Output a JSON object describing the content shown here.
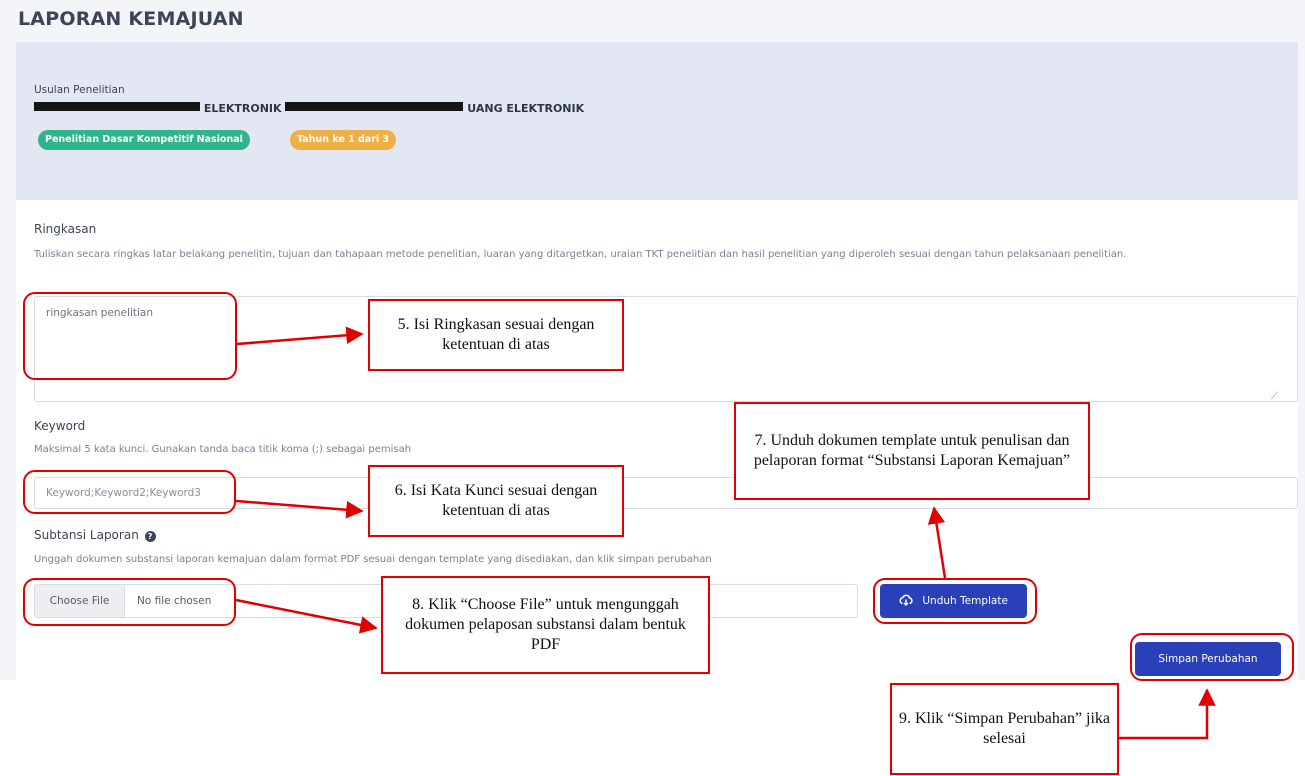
{
  "page": {
    "title": "LAPORAN KEMAJUAN"
  },
  "proposal": {
    "label": "Usulan Penelitian",
    "title_parts": [
      "ELEKTRONIK",
      "UANG ELEKTRONIK"
    ],
    "badges": [
      "Penelitian Dasar Kompetitif Nasional",
      "Tahun ke 1 dari 3"
    ],
    "badge_colors": [
      "#2fb58d",
      "#eeb044"
    ]
  },
  "ringkasan": {
    "label": "Ringkasan",
    "description": "Tuliskan secara ringkas latar belakang penelitin, tujuan dan tahapaan metode penelitian, luaran yang ditargetkan, uraian TKT penelitian dan hasil penelitian yang diperoleh sesuai dengan tahun pelaksanaan penelitian.",
    "value": "ringkasan penelitian"
  },
  "keyword": {
    "label": "Keyword",
    "description": "Maksimal 5 kata kunci. Gunakan tanda baca titik koma (;) sebagai pemisah",
    "placeholder": "Keyword;Keyword2;Keyword3"
  },
  "substansi": {
    "label": "Subtansi Laporan",
    "description": "Unggah dokumen substansi laporan kemajuan dalam format PDF sesuai dengan template yang disediakan, dan klik simpan perubahan",
    "choose_file": "Choose File",
    "no_file": "No file chosen",
    "download_label": "Unduh Template"
  },
  "actions": {
    "save_label": "Simpan Perubahan"
  },
  "colors": {
    "primary": "#2a40b9",
    "annotation": "#e00000",
    "header_bg": "#e3e7f3"
  },
  "annotations": {
    "step5": "5. Isi Ringkasan sesuai dengan ketentuan di atas",
    "step6": "6. Isi Kata Kunci sesuai dengan ketentuan di atas",
    "step7": "7. Unduh dokumen template untuk penulisan dan pelaporan format “Substansi Laporan Kemajuan”",
    "step8": "8. Klik “Choose File” untuk mengunggah dokumen pelaposan substansi dalam bentuk PDF",
    "step9": "9. Klik “Simpan Perubahan” jika selesai"
  }
}
